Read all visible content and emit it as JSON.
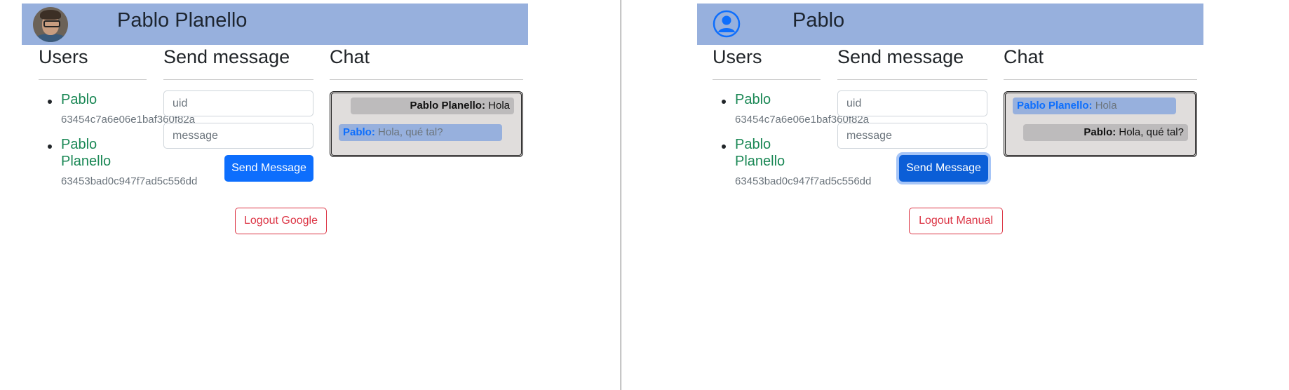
{
  "panes": [
    {
      "header": {
        "title": "Pablo Planello",
        "avatar": "user-photo"
      },
      "columns": {
        "users": "Users",
        "send": "Send message",
        "chat": "Chat"
      },
      "users": [
        {
          "name": "Pablo",
          "id": "63454c7a6e06e1baf360f82a"
        },
        {
          "name": "Pablo Planello",
          "id": "63453bad0c947f7ad5c556dd"
        }
      ],
      "form": {
        "uid_placeholder": "uid",
        "message_placeholder": "message",
        "send_label": "Send Message"
      },
      "logout_label": "Logout Google",
      "chat": [
        {
          "sender": "Pablo Planello:",
          "text": "Hola",
          "mine": true
        },
        {
          "sender": "Pablo:",
          "text": "Hola, qué tal?",
          "mine": false
        }
      ]
    },
    {
      "header": {
        "title": "Pablo",
        "avatar": "user-circle-icon"
      },
      "columns": {
        "users": "Users",
        "send": "Send message",
        "chat": "Chat"
      },
      "users": [
        {
          "name": "Pablo",
          "id": "63454c7a6e06e1baf360f82a"
        },
        {
          "name": "Pablo Planello",
          "id": "63453bad0c947f7ad5c556dd"
        }
      ],
      "form": {
        "uid_placeholder": "uid",
        "message_placeholder": "message",
        "send_label": "Send Message"
      },
      "logout_label": "Logout Manual",
      "chat": [
        {
          "sender": "Pablo Planello:",
          "text": "Hola",
          "mine": false
        },
        {
          "sender": "Pablo:",
          "text": "Hola, qué tal?",
          "mine": true
        }
      ]
    }
  ],
  "colors": {
    "header_bg": "#97b0dd",
    "user_name": "#198754",
    "primary": "#0d6efd",
    "danger": "#dc3545",
    "chat_bg": "#e0dddc"
  }
}
